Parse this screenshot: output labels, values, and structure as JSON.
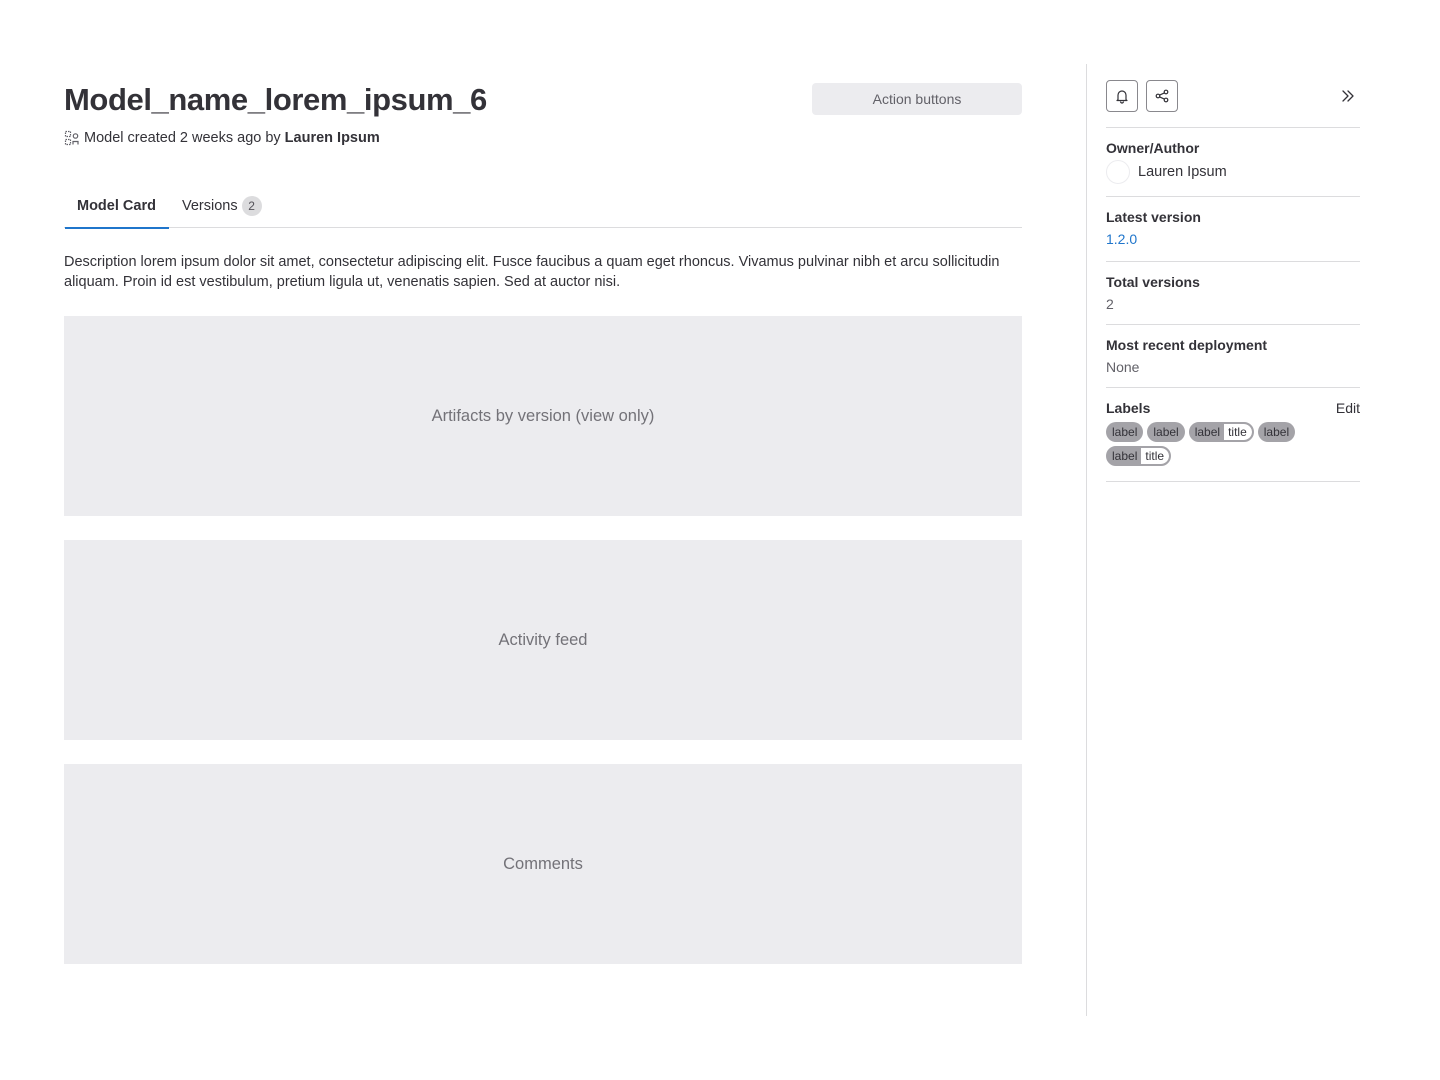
{
  "header": {
    "title": "Model_name_lorem_ipsum_6",
    "action_buttons_label": "Action buttons",
    "meta": {
      "created_text": "Model created 2 weeks ago by",
      "author": "Lauren Ipsum"
    }
  },
  "tabs": [
    {
      "label": "Model Card",
      "active": true
    },
    {
      "label": "Versions",
      "count": "2",
      "active": false
    }
  ],
  "description": "Description lorem ipsum dolor sit amet, consectetur adipiscing elit. Fusce faucibus a quam eget rhoncus. Vivamus pulvinar nibh et arcu sollicitudin aliquam. Proin id est vestibulum, pretium ligula ut, venenatis sapien. Sed at auctor nisi.",
  "placeholders": {
    "artifacts": "Artifacts by version (view only)",
    "activity": "Activity feed",
    "comments": "Comments"
  },
  "sidebar": {
    "icons": {
      "notify": "bell-icon",
      "share": "share-icon",
      "collapse": "chevron-double-right-icon"
    },
    "owner": {
      "title": "Owner/Author",
      "name": "Lauren Ipsum"
    },
    "latest_version": {
      "title": "Latest version",
      "value": "1.2.0"
    },
    "total_versions": {
      "title": "Total versions",
      "value": "2"
    },
    "recent_deployment": {
      "title": "Most recent deployment",
      "value": "None"
    },
    "labels": {
      "title": "Labels",
      "edit": "Edit",
      "items": [
        {
          "key": "label"
        },
        {
          "key": "label"
        },
        {
          "key": "label",
          "value": "title"
        },
        {
          "key": "label"
        },
        {
          "key": "label",
          "value": "title"
        }
      ]
    }
  },
  "colors": {
    "accent": "#1f75cb",
    "text": "#333238",
    "placeholder_bg": "#ececef",
    "label_bg": "#a4a3a8"
  }
}
